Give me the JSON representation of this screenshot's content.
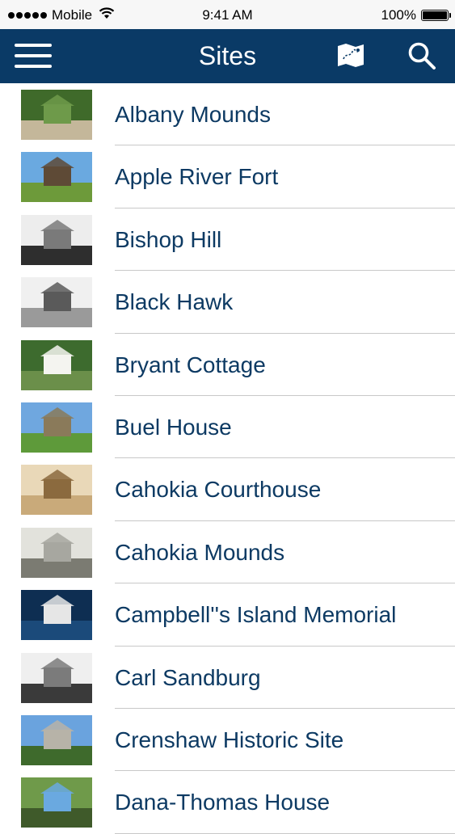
{
  "status_bar": {
    "carrier": "Mobile",
    "time": "9:41 AM",
    "battery": "100%"
  },
  "nav": {
    "title": "Sites",
    "menu_icon": "hamburger-menu-icon",
    "map_icon": "map-icon",
    "search_icon": "search-icon"
  },
  "sites": [
    {
      "name": "Albany Mounds",
      "thumb_colors": [
        "#3f6a2a",
        "#6e9a4a",
        "#c4b79a"
      ]
    },
    {
      "name": "Apple River Fort",
      "thumb_colors": [
        "#6aa9e0",
        "#5e4a36",
        "#6d9a3a"
      ]
    },
    {
      "name": "Bishop Hill",
      "thumb_colors": [
        "#ededed",
        "#7a7a7a",
        "#2e2e2e"
      ]
    },
    {
      "name": "Black Hawk",
      "thumb_colors": [
        "#f0f0f0",
        "#5a5a5a",
        "#9a9a9a"
      ]
    },
    {
      "name": "Bryant Cottage",
      "thumb_colors": [
        "#3d6b2e",
        "#f4f4f0",
        "#6b8f4a"
      ]
    },
    {
      "name": "Buel House",
      "thumb_colors": [
        "#6fa7df",
        "#8a7a5a",
        "#5e9a3a"
      ]
    },
    {
      "name": "Cahokia Courthouse",
      "thumb_colors": [
        "#e9d8b8",
        "#8b6a3e",
        "#c9aa7a"
      ]
    },
    {
      "name": "Cahokia Mounds",
      "thumb_colors": [
        "#e2e2dc",
        "#a7a7a0",
        "#7b7b72"
      ]
    },
    {
      "name": "Campbell''s Island Memorial",
      "thumb_colors": [
        "#0e2e52",
        "#e6e6e6",
        "#1b4a7a"
      ]
    },
    {
      "name": "Carl Sandburg",
      "thumb_colors": [
        "#efefef",
        "#7b7b7b",
        "#3a3a3a"
      ]
    },
    {
      "name": "Crenshaw Historic Site",
      "thumb_colors": [
        "#6aa3de",
        "#b7b3a8",
        "#3e6a2c"
      ]
    },
    {
      "name": "Dana-Thomas House",
      "thumb_colors": [
        "#6f9a4a",
        "#6aa9e0",
        "#3f5a2a"
      ]
    }
  ]
}
